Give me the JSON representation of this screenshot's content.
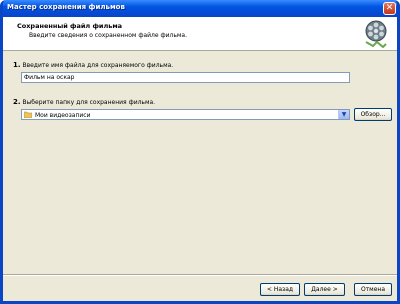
{
  "window": {
    "title": "Мастер сохранения фильмов",
    "close": "✕"
  },
  "header": {
    "title": "Сохраненный файл фильма",
    "subtitle": "Введите сведения о сохраненном файле фильма.",
    "icon": "film-reel-icon"
  },
  "step1": {
    "number": "1.",
    "label": "Введите имя файла для сохраняемого фильма.",
    "value": "Фильм на оскар"
  },
  "step2": {
    "number": "2.",
    "label": "Выберите папку для сохранения фильма.",
    "folder": "Мои видеозаписи",
    "browse_label": "Обзор..."
  },
  "footer": {
    "back_label": "< Назад",
    "next_label": "Далее >",
    "cancel_label": "Отмена"
  }
}
